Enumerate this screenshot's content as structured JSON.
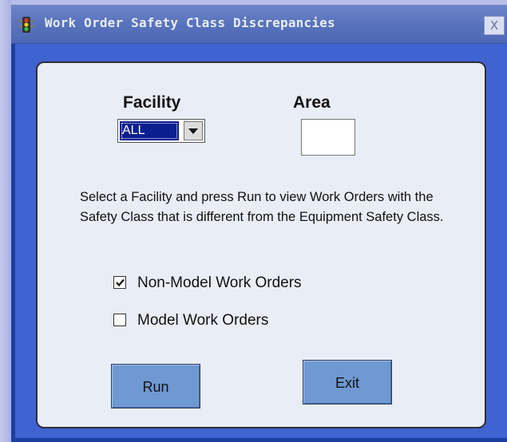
{
  "window": {
    "title": "Work Order Safety Class Discrepancies",
    "close_glyph": "X",
    "icon": "traffic-light-icon"
  },
  "form": {
    "facility_label": "Facility",
    "facility_value": "ALL",
    "area_label": "Area",
    "area_value": "",
    "description": "Select a Facility and press Run to view Work Orders with the Safety Class that is different from the Equipment Safety Class.",
    "non_model_label": "Non-Model Work Orders",
    "non_model_checked": true,
    "model_label": "Model Work Orders",
    "model_checked": false,
    "run_label": "Run",
    "exit_label": "Exit"
  },
  "colors": {
    "panel_background": "#e9edf6",
    "button_background": "#6e99d2",
    "client_background": "#3f63d0",
    "selected_value_background": "#0a1f8f"
  }
}
